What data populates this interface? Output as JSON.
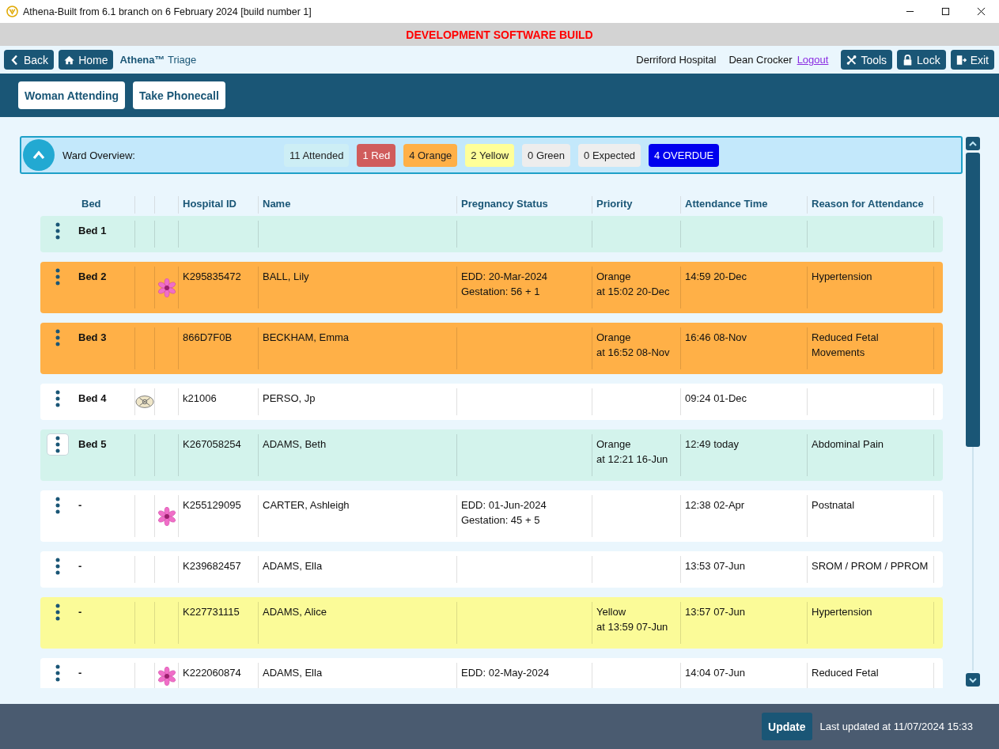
{
  "window": {
    "title": "Athena-Built from 6.1 branch on 6 February 2024 [build number 1]"
  },
  "banner": "DEVELOPMENT SOFTWARE BUILD",
  "nav": {
    "back": "Back",
    "home": "Home",
    "app_name": "Athena™",
    "app_section": "Triage",
    "hospital": "Derriford Hospital",
    "user": "Dean Crocker",
    "logout": "Logout",
    "buttons": [
      "Tools",
      "Lock",
      "Exit"
    ]
  },
  "actions": [
    "Woman Attending",
    "Take Phonecall"
  ],
  "overview": {
    "label": "Ward Overview:",
    "expanded": true,
    "chips": [
      {
        "text": "11 Attended",
        "color": "#cdeef5"
      },
      {
        "text": "1 Red",
        "color": "#d05c5c"
      },
      {
        "text": "4 Orange",
        "color": "#ffb047"
      },
      {
        "text": "2 Yellow",
        "color": "#ffff99"
      },
      {
        "text": "0 Green",
        "color": "#ededed"
      },
      {
        "text": "0 Expected",
        "color": "#eeeeee"
      },
      {
        "text": "4 OVERDUE",
        "color": "#0000ee"
      }
    ]
  },
  "table": {
    "columns": [
      "Bed",
      "Hospital ID",
      "Name",
      "Pregnancy Status",
      "Priority",
      "Attendance Time",
      "Reason for Attendance"
    ],
    "rows": [
      {
        "bed": "Bed 1",
        "color": "#d3f3ec",
        "menu_active": false,
        "pas": false,
        "flower": false,
        "hospital_id": "",
        "name": "",
        "pregnancy": [],
        "priority": [],
        "attendance": "",
        "reason": ""
      },
      {
        "bed": "Bed 2",
        "color": "#ffb047",
        "menu_active": false,
        "pas": false,
        "flower": true,
        "hospital_id": "K295835472",
        "name": "BALL, Lily",
        "pregnancy": [
          "EDD: 20-Mar-2024",
          "Gestation: 56 + 1"
        ],
        "priority": [
          "Orange",
          "at 15:02 20-Dec"
        ],
        "attendance": "14:59 20-Dec",
        "reason": "Hypertension"
      },
      {
        "bed": "Bed 3",
        "color": "#ffb047",
        "menu_active": false,
        "pas": false,
        "flower": false,
        "hospital_id": "866D7F0B",
        "name": "BECKHAM, Emma",
        "pregnancy": [],
        "priority": [
          "Orange",
          "at 16:52 08-Nov"
        ],
        "attendance": "16:46 08-Nov",
        "reason": "Reduced Fetal Movements"
      },
      {
        "bed": "Bed 4",
        "color": "#ffffff",
        "menu_active": false,
        "pas": true,
        "flower": false,
        "hospital_id": "k21006",
        "name": "PERSO, Jp",
        "pregnancy": [],
        "priority": [],
        "attendance": "09:24 01-Dec",
        "reason": ""
      },
      {
        "bed": "Bed 5",
        "color": "#d3f3ec",
        "menu_active": true,
        "pas": false,
        "flower": false,
        "hospital_id": "K267058254",
        "name": "ADAMS, Beth",
        "pregnancy": [],
        "priority": [
          "Orange",
          "at 12:21 16-Jun"
        ],
        "attendance": "12:49 today",
        "reason": "Abdominal Pain"
      },
      {
        "bed": "-",
        "color": "#ffffff",
        "menu_active": false,
        "pas": false,
        "flower": true,
        "hospital_id": "K255129095",
        "name": "CARTER, Ashleigh",
        "pregnancy": [
          "EDD: 01-Jun-2024",
          "Gestation: 45 + 5"
        ],
        "priority": [],
        "attendance": "12:38 02-Apr",
        "reason": "Postnatal"
      },
      {
        "bed": "-",
        "color": "#ffffff",
        "menu_active": false,
        "pas": false,
        "flower": false,
        "hospital_id": "K239682457",
        "name": "ADAMS, Ella",
        "pregnancy": [],
        "priority": [],
        "attendance": "13:53 07-Jun",
        "reason": "SROM / PROM / PPROM"
      },
      {
        "bed": "-",
        "color": "#fbfb98",
        "menu_active": false,
        "pas": false,
        "flower": false,
        "hospital_id": "K227731115",
        "name": "ADAMS, Alice",
        "pregnancy": [],
        "priority": [
          "Yellow",
          "at 13:59 07-Jun"
        ],
        "attendance": "13:57 07-Jun",
        "reason": "Hypertension"
      },
      {
        "bed": "-",
        "color": "#ffffff",
        "menu_active": false,
        "pas": false,
        "flower": true,
        "hospital_id": "K222060874",
        "name": "ADAMS, Ella",
        "pregnancy": [
          "EDD: 02-May-2024"
        ],
        "priority": [],
        "attendance": "14:04 07-Jun",
        "reason": "Reduced Fetal"
      }
    ]
  },
  "footer": {
    "update": "Update",
    "last_updated": "Last updated at 11/07/2024 15:33"
  }
}
